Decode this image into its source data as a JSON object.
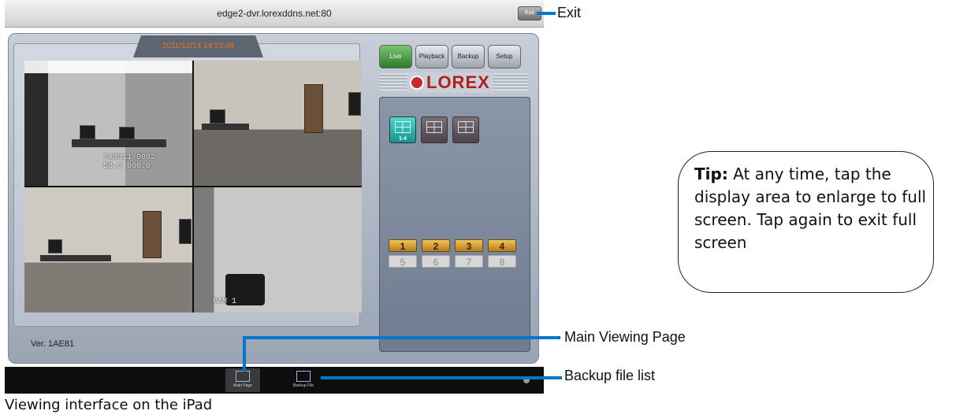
{
  "window": {
    "url_title": "edge2-dvr.lorexddns.net:80",
    "exit_button": "Exit"
  },
  "header": {
    "datetime": "2011/12/14 14:23:49"
  },
  "tabs": [
    {
      "label": "Live",
      "active": true
    },
    {
      "label": "Playback",
      "active": false
    },
    {
      "label": "Backup",
      "active": false
    },
    {
      "label": "Setup",
      "active": false
    }
  ],
  "logo": {
    "text": "LOREX"
  },
  "cameras": {
    "cam1_overlay": "TA0011-0002\n58.6 000.0",
    "cam4_label": "CAM 1"
  },
  "layouts": [
    {
      "label": "1-4",
      "active": true
    },
    {
      "label": "",
      "active": false
    },
    {
      "label": "",
      "active": false
    }
  ],
  "channels": [
    {
      "label": "1",
      "active": true
    },
    {
      "label": "2",
      "active": true
    },
    {
      "label": "3",
      "active": true
    },
    {
      "label": "4",
      "active": true
    },
    {
      "label": "5",
      "active": false
    },
    {
      "label": "6",
      "active": false
    },
    {
      "label": "7",
      "active": false
    },
    {
      "label": "8",
      "active": false
    }
  ],
  "version": "Ver. 1AE81",
  "bottom_bar": {
    "main_page": "Main Page",
    "backup_file": "Backup File"
  },
  "callouts": {
    "exit": "Exit",
    "main_viewing_page": "Main Viewing Page",
    "backup_file_list": "Backup file list"
  },
  "tip": {
    "label": "Tip:",
    "text": " At any time, tap the display area to enlarge to full screen. Tap again to exit full screen"
  },
  "caption": "Viewing interface on the iPad",
  "colors": {
    "callout_line": "#0077c8",
    "accent_live": "#2f7a2b",
    "logo_red": "#b31e1e"
  }
}
